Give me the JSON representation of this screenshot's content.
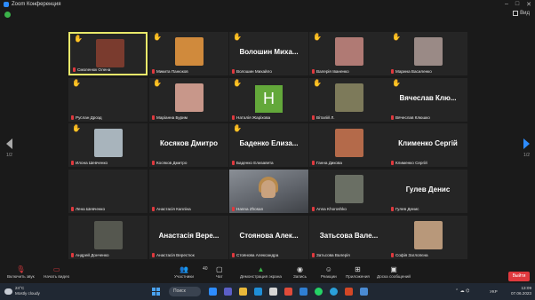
{
  "window": {
    "title": "Zoom Конференция"
  },
  "view_button": "Вид",
  "pagination": {
    "left": "1/2",
    "right": "1/2"
  },
  "participants": [
    {
      "tag": "Смоленюк Олена",
      "hand": "raised",
      "kind": "photo",
      "photo_color": "#7a3b2e",
      "speaker": true
    },
    {
      "tag": "Микита Панюков",
      "hand": "raised-dim",
      "kind": "photo",
      "photo_color": "#d08a3c"
    },
    {
      "tag": "Волошин Михайло",
      "hand": "raised",
      "kind": "name",
      "big": "Волошин Миха..."
    },
    {
      "tag": "Валерія Іваненко",
      "hand": "raised",
      "kind": "photo",
      "photo_color": "#b07a74"
    },
    {
      "tag": "Марина Василенко",
      "hand": "raised",
      "kind": "photo",
      "photo_color": "#9a8a86"
    },
    {
      "tag": "Руслан Дрозд",
      "hand": "raised",
      "kind": "empty"
    },
    {
      "tag": "Маріанна Бурим",
      "hand": "raised",
      "kind": "photo",
      "photo_color": "#c8978a"
    },
    {
      "tag": "Наталія Жаріхова",
      "hand": "raised",
      "kind": "initial",
      "initial": "H"
    },
    {
      "tag": "Віталій Л.",
      "hand": "raised",
      "kind": "photo",
      "photo_color": "#7d7a5a"
    },
    {
      "tag": "Вячеслав Клюшко",
      "hand": "raised",
      "kind": "name",
      "big": "Вячеслав Клю..."
    },
    {
      "tag": "Илона Шевченко",
      "hand": "raised",
      "kind": "photo",
      "photo_color": "#a8b4bc"
    },
    {
      "tag": "Косяков Дмитро",
      "hand": "none",
      "kind": "name",
      "big": "Косяков Дмитро"
    },
    {
      "tag": "Баденко Елизавета",
      "hand": "raised",
      "kind": "name",
      "big": "Баденко Елиза..."
    },
    {
      "tag": "Ганна Дикова",
      "hand": "none",
      "kind": "photo",
      "photo_color": "#b46a4a"
    },
    {
      "tag": "Клименко Сергій",
      "hand": "none",
      "kind": "name",
      "big": "Клименко Сергій"
    },
    {
      "tag": "Лена Шевченко",
      "hand": "none",
      "kind": "empty"
    },
    {
      "tag": "Анастасія Капліна",
      "hand": "none",
      "kind": "empty"
    },
    {
      "tag": "Hanna Zhosan",
      "hand": "none",
      "kind": "video"
    },
    {
      "tag": "Anna Khoroshko",
      "hand": "none",
      "kind": "photo",
      "photo_color": "#6a6f64"
    },
    {
      "tag": "Гулев Денис",
      "hand": "none",
      "kind": "name",
      "big": "Гулев Денис"
    },
    {
      "tag": "Андрей Донченко",
      "hand": "none",
      "kind": "photo",
      "photo_color": "#55574f"
    },
    {
      "tag": "Анастасія Верестюк",
      "hand": "none",
      "kind": "name",
      "big": "Анастасія Вере..."
    },
    {
      "tag": "Стоянова Александра",
      "hand": "none",
      "kind": "name",
      "big": "Стоянова Алек..."
    },
    {
      "tag": "Затьсова Валерія",
      "hand": "none",
      "kind": "name",
      "big": "Затьсова Вале..."
    },
    {
      "tag": "Софія Заглопєна",
      "hand": "none",
      "kind": "photo",
      "photo_color": "#b8987a"
    }
  ],
  "toolbar": {
    "audio": "Включить звук",
    "video": "Начать видео",
    "participants": "Участники",
    "participants_count": "40",
    "chat": "Чат",
    "share": "Демонстрация экрана",
    "record": "Запись",
    "reactions": "Реакции",
    "apps": "Приложения",
    "whiteboard": "Доска сообщений",
    "leave": "Выйти"
  },
  "taskbar": {
    "temperature": "24°C",
    "weather": "Mostly cloudy",
    "search": "Поиск",
    "language": "УКР",
    "time": "13:09",
    "date": "07.06.2023"
  }
}
